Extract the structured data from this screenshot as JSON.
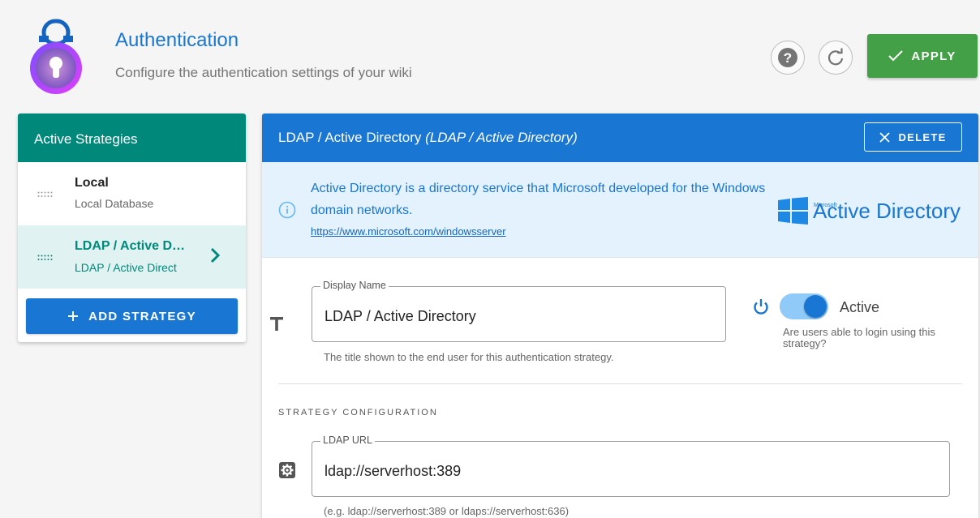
{
  "header": {
    "title": "Authentication",
    "subtitle": "Configure the authentication settings of your wiki",
    "apply_label": "APPLY"
  },
  "left_panel": {
    "title": "Active Strategies",
    "items": [
      {
        "title": "Local",
        "subtitle": "Local Database"
      },
      {
        "title": "LDAP / Active D…",
        "subtitle": "LDAP / Active Direct"
      }
    ],
    "add_label": "ADD STRATEGY"
  },
  "right_panel": {
    "title": "LDAP / Active Directory",
    "title_italic": "(LDAP / Active Directory)",
    "delete_label": "DELETE",
    "info": {
      "text": "Active Directory is a directory service that Microsoft developed for the Windows domain networks.",
      "link": "https://www.microsoft.com/windowsserver",
      "logo_small": "Microsoft",
      "logo_text": "Active Directory"
    },
    "display_name": {
      "label": "Display Name",
      "value": "LDAP / Active Directory",
      "hint": "The title shown to the end user for this authentication strategy."
    },
    "active_toggle": {
      "label": "Active",
      "hint": "Are users able to login using this strategy?",
      "on": true
    },
    "section_label": "STRATEGY CONFIGURATION",
    "ldap_url": {
      "label": "LDAP URL",
      "value": "ldap://serverhost:389",
      "hint": "(e.g. ldap://serverhost:389 or ldaps://serverhost:636)"
    }
  },
  "colors": {
    "primary": "#1976d2",
    "teal": "#00897b",
    "success": "#43a047",
    "info_bg": "#e3f2fd"
  }
}
